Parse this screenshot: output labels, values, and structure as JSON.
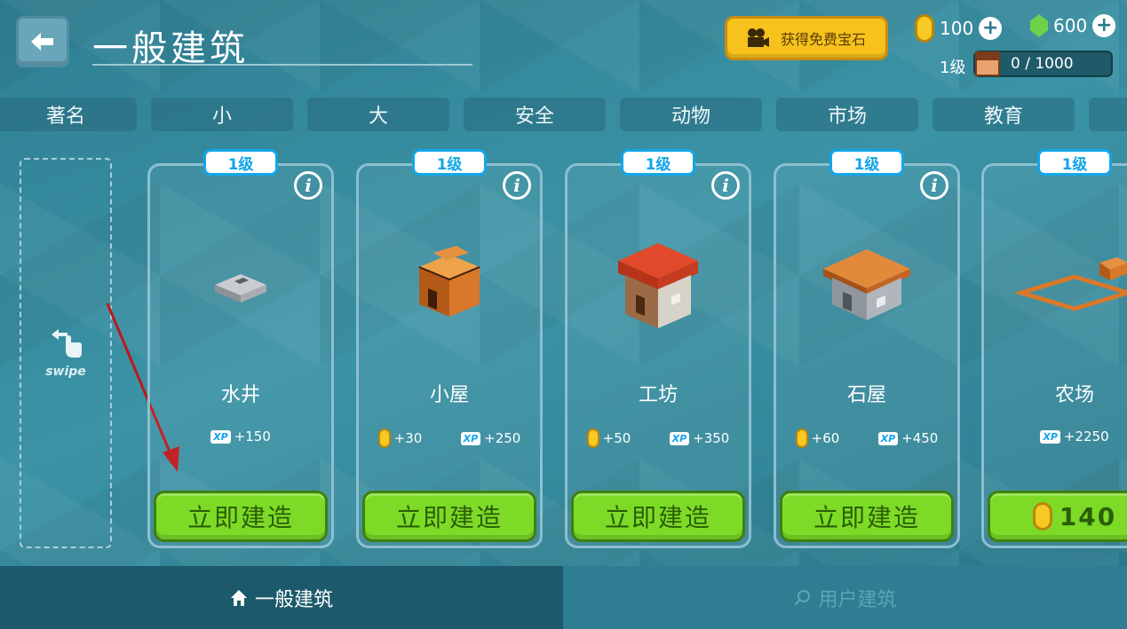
{
  "header": {
    "title": "一般建筑",
    "free_gems_label": "获得免费宝石",
    "coins": "100",
    "gems": "600",
    "level_label": "1级",
    "xp_progress": "0 / 1000"
  },
  "tabs": [
    "著名",
    "小",
    "大",
    "安全",
    "动物",
    "市场",
    "教育"
  ],
  "swipe_label": "swipe",
  "cards": [
    {
      "level": "1级",
      "name": "水井",
      "coin_reward": "",
      "xp_reward": "+150",
      "button": "立即建造"
    },
    {
      "level": "1级",
      "name": "小屋",
      "coin_reward": "+30",
      "xp_reward": "+250",
      "button": "立即建造"
    },
    {
      "level": "1级",
      "name": "工坊",
      "coin_reward": "+50",
      "xp_reward": "+350",
      "button": "立即建造"
    },
    {
      "level": "1级",
      "name": "石屋",
      "coin_reward": "+60",
      "xp_reward": "+450",
      "button": "立即建造"
    },
    {
      "level": "1级",
      "name": "农场",
      "coin_reward": "",
      "xp_reward": "+2250",
      "button": "140"
    }
  ],
  "xp_badge": "XP",
  "info_glyph": "i",
  "bottom_tabs": {
    "general": "一般建筑",
    "user": "用户建筑"
  },
  "colors": {
    "accent_green": "#7ddb27",
    "level_blue": "#13a6e8",
    "gold": "#f7c21c"
  }
}
